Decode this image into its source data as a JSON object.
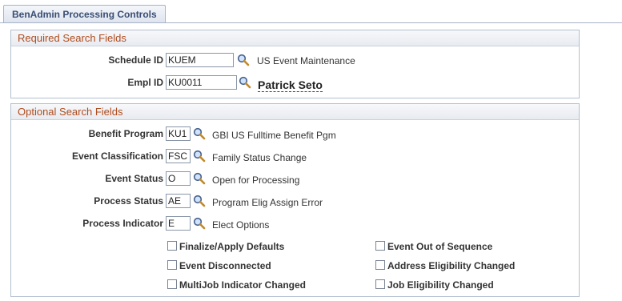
{
  "page": {
    "tab_label": "BenAdmin Processing Controls"
  },
  "required": {
    "title": "Required Search Fields",
    "schedule_id": {
      "label": "Schedule ID",
      "value": "KUEM",
      "description": "US Event Maintenance"
    },
    "empl_id": {
      "label": "Empl ID",
      "value": "KU0011",
      "description": "Patrick Seto"
    }
  },
  "optional": {
    "title": "Optional Search Fields",
    "fields": [
      {
        "label": "Benefit Program",
        "value": "KU1",
        "description": "GBI US Fulltime Benefit Pgm"
      },
      {
        "label": "Event Classification",
        "value": "FSC",
        "description": "Family Status Change"
      },
      {
        "label": "Event Status",
        "value": "O",
        "description": "Open for Processing"
      },
      {
        "label": "Process Status",
        "value": "AE",
        "description": "Program Elig Assign Error"
      },
      {
        "label": "Process Indicator",
        "value": "E",
        "description": "Elect Options"
      }
    ],
    "checkboxes_left": [
      {
        "label": "Finalize/Apply Defaults",
        "checked": false
      },
      {
        "label": "Event Disconnected",
        "checked": false
      },
      {
        "label": "MultiJob Indicator Changed",
        "checked": false
      }
    ],
    "checkboxes_right": [
      {
        "label": "Event Out of Sequence",
        "checked": false
      },
      {
        "label": "Address Eligibility Changed",
        "checked": false
      },
      {
        "label": "Job Eligibility Changed",
        "checked": false
      }
    ]
  },
  "icons": {
    "lookup": "magnifier-lookup-icon"
  }
}
